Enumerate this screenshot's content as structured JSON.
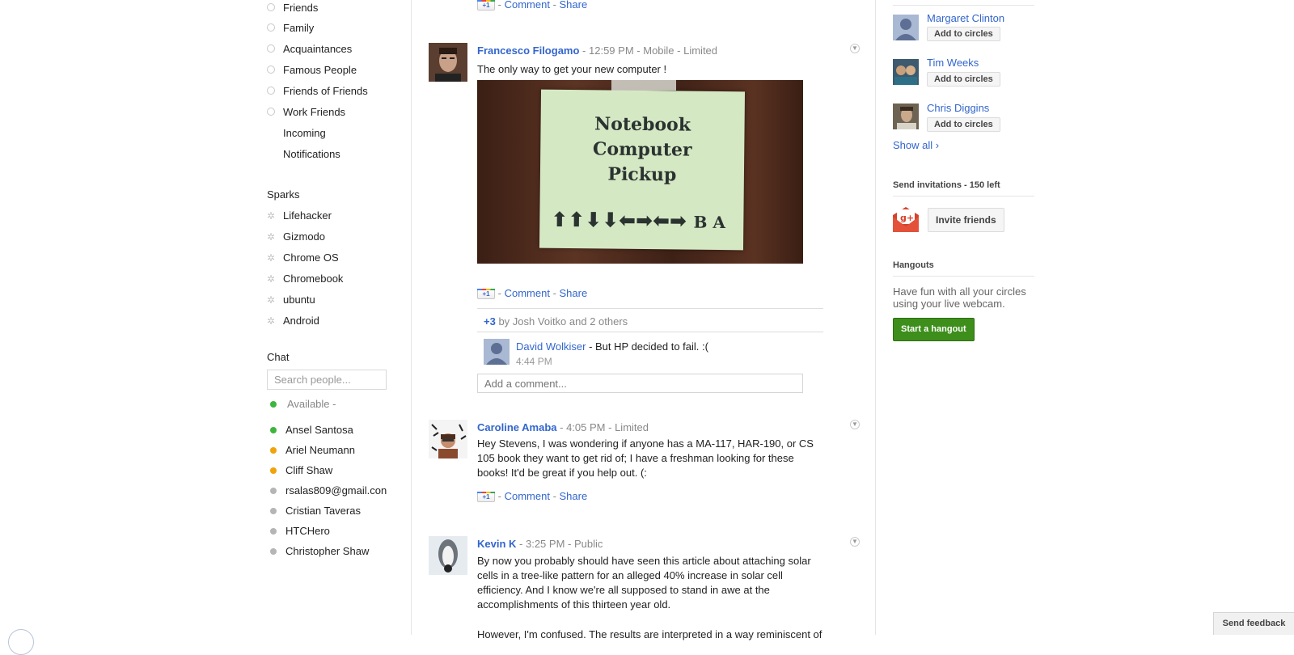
{
  "circles": [
    "Friends",
    "Family",
    "Acquaintances",
    "Famous People",
    "Friends of Friends",
    "Work Friends"
  ],
  "nav_links": [
    "Incoming",
    "Notifications"
  ],
  "sparks": {
    "title": "Sparks",
    "items": [
      "Lifehacker",
      "Gizmodo",
      "Chrome OS",
      "Chromebook",
      "ubuntu",
      "Android"
    ]
  },
  "chat": {
    "title": "Chat",
    "search_placeholder": "Search people...",
    "status": "Available -",
    "contacts": [
      {
        "name": "Ansel Santosa",
        "status_color": "#3eb53e"
      },
      {
        "name": "Ariel Neumann",
        "status_color": "#f0a30a"
      },
      {
        "name": "Cliff Shaw",
        "status_color": "#f0a30a"
      },
      {
        "name": "rsalas809@gmail.con",
        "status_color": "#b5b5b5"
      },
      {
        "name": "Cristian Taveras",
        "status_color": "#b5b5b5"
      },
      {
        "name": "HTCHero",
        "status_color": "#b5b5b5"
      },
      {
        "name": "Christopher Shaw",
        "status_color": "#b5b5b5"
      }
    ]
  },
  "top_actions": {
    "comment": "Comment",
    "share": "Share"
  },
  "posts": [
    {
      "author": "Francesco Filogamo",
      "time": "12:59 PM",
      "source": "Mobile",
      "visibility": "Limited",
      "text": "The only way to get your new computer !",
      "image_sign": {
        "line1": "Notebook",
        "line2": "Computer",
        "line3": "Pickup",
        "code": "B A"
      },
      "comment_label": "Comment",
      "share_label": "Share",
      "plus_count": "+3",
      "plus_by": "by Josh Voitko and 2 others",
      "comment": {
        "author": "David Wolkiser",
        "text": " - But HP decided to fail. :(",
        "time": "4:44 PM"
      },
      "add_comment_placeholder": "Add a comment..."
    },
    {
      "author": "Caroline Amaba",
      "time": "4:05 PM",
      "visibility": "Limited",
      "text": "Hey Stevens, I was wondering if anyone has a MA-117, HAR-190, or CS 105 book they want to get rid of; I have a freshman looking for these books! It'd be great if you help out. (:",
      "comment_label": "Comment",
      "share_label": "Share"
    },
    {
      "author": "Kevin K",
      "time": "3:25 PM",
      "visibility": "Public",
      "text": "By now you probably should have seen this article about attaching solar cells in a tree-like pattern for an alleged 40% increase in solar cell efficiency. And I know we're all supposed to stand in awe at the accomplishments of this thirteen year old.",
      "text2": "However, I'm confused. The results are interpreted in a way reminiscent of"
    }
  ],
  "suggestions": [
    {
      "name": "Margaret Clinton",
      "button": "Add to circles"
    },
    {
      "name": "Tim Weeks",
      "button": "Add to circles"
    },
    {
      "name": "Chris Diggins",
      "button": "Add to circles"
    }
  ],
  "show_all": "Show all ›",
  "invitations": {
    "title": "Send invitations - 150 left",
    "button": "Invite friends"
  },
  "hangouts": {
    "title": "Hangouts",
    "text": "Have fun with all your circles using your live webcam.",
    "button": "Start a hangout"
  },
  "feedback": "Send feedback",
  "colors": {
    "link": "#3366cc",
    "hangout_green": "#3d8e1b"
  }
}
